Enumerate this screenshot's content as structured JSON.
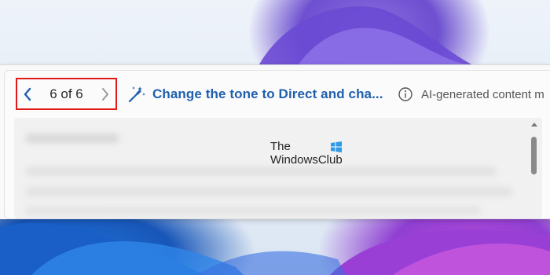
{
  "pager": {
    "count": "6 of 6",
    "prev_icon": "chevron-left-icon",
    "next_icon": "chevron-right-icon",
    "highlight_color": "#e0191a"
  },
  "action": {
    "label": "Change the tone to Direct and cha...",
    "icon": "magic-wand-icon",
    "color": "#1f5fae"
  },
  "note": {
    "text": "AI-generated content m",
    "icon": "info-icon"
  },
  "watermark": {
    "line1": "The",
    "line2": "WindowsClub"
  }
}
